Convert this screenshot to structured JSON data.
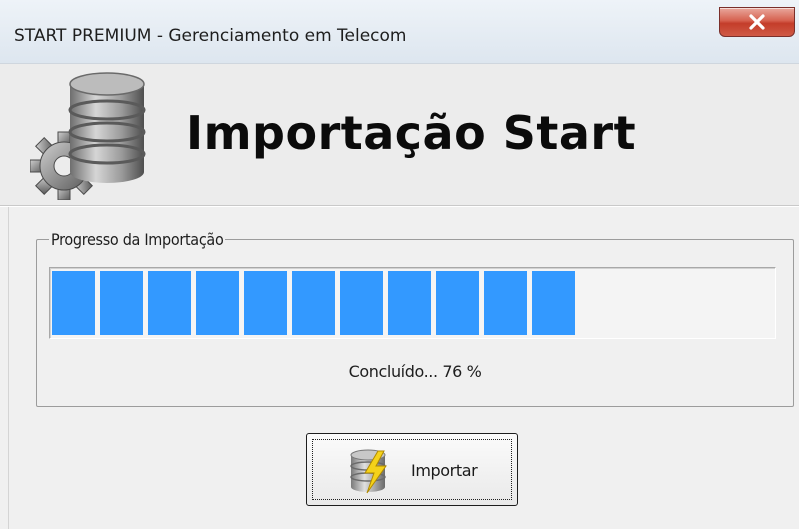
{
  "window": {
    "title": "START PREMIUM - Gerenciamento em Telecom",
    "close_icon": "close-icon"
  },
  "header": {
    "icon": "database-gear-icon",
    "title": "Importação Start"
  },
  "progress_group": {
    "legend": "Progresso da Importação",
    "progress_fraction": 0.76,
    "status": "Concluído... 76 %"
  },
  "actions": {
    "import_label": "Importar",
    "import_icon": "database-lightning-icon"
  },
  "colors": {
    "progress_block": "#3399ff",
    "close_button": "#c43d2a"
  }
}
